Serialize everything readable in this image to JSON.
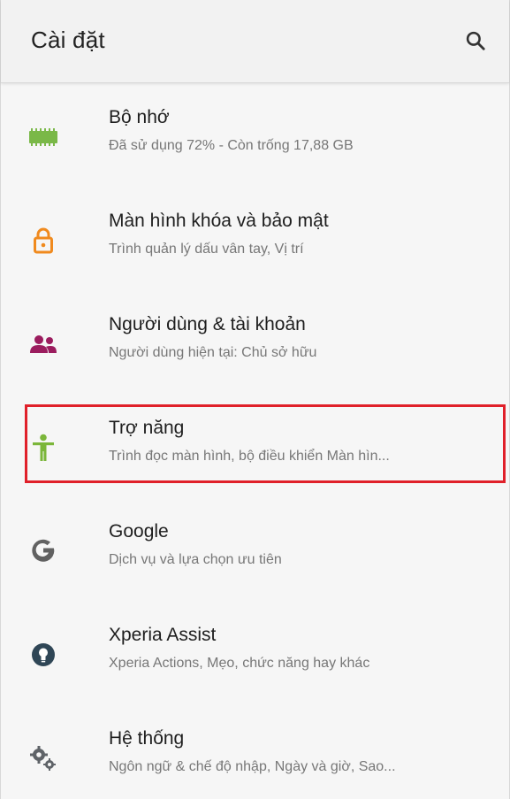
{
  "header": {
    "title": "Cài đặt",
    "search_icon": "search-icon"
  },
  "colors": {
    "storage": "#7ab848",
    "lock": "#f08a1e",
    "users": "#9b1c5e",
    "accessibility": "#7bb63a",
    "google": "#616161",
    "xperia": "#2f4656",
    "system": "#5f6368",
    "highlight": "#e0202a"
  },
  "settings": {
    "items": [
      {
        "icon": "storage-icon",
        "label": "Bộ nhớ",
        "sub": "Đã sử dụng 72% - Còn trống 17,88 GB"
      },
      {
        "icon": "lock-icon",
        "label": "Màn hình khóa và bảo mật",
        "sub": "Trình quản lý dấu vân tay, Vị trí"
      },
      {
        "icon": "users-icon",
        "label": "Người dùng & tài khoản",
        "sub": "Người dùng hiện tại: Chủ sở hữu"
      },
      {
        "icon": "accessibility-icon",
        "label": "Trợ năng",
        "sub": "Trình đọc màn hình, bộ điều khiển Màn hìn..."
      },
      {
        "icon": "google-icon",
        "label": "Google",
        "sub": "Dịch vụ và lựa chọn ưu tiên"
      },
      {
        "icon": "xperia-assist-icon",
        "label": "Xperia Assist",
        "sub": "Xperia Actions, Mẹo, chức năng hay khác"
      },
      {
        "icon": "gears-icon",
        "label": "Hệ thống",
        "sub": "Ngôn ngữ & chế độ nhập, Ngày và giờ, Sao..."
      }
    ]
  }
}
